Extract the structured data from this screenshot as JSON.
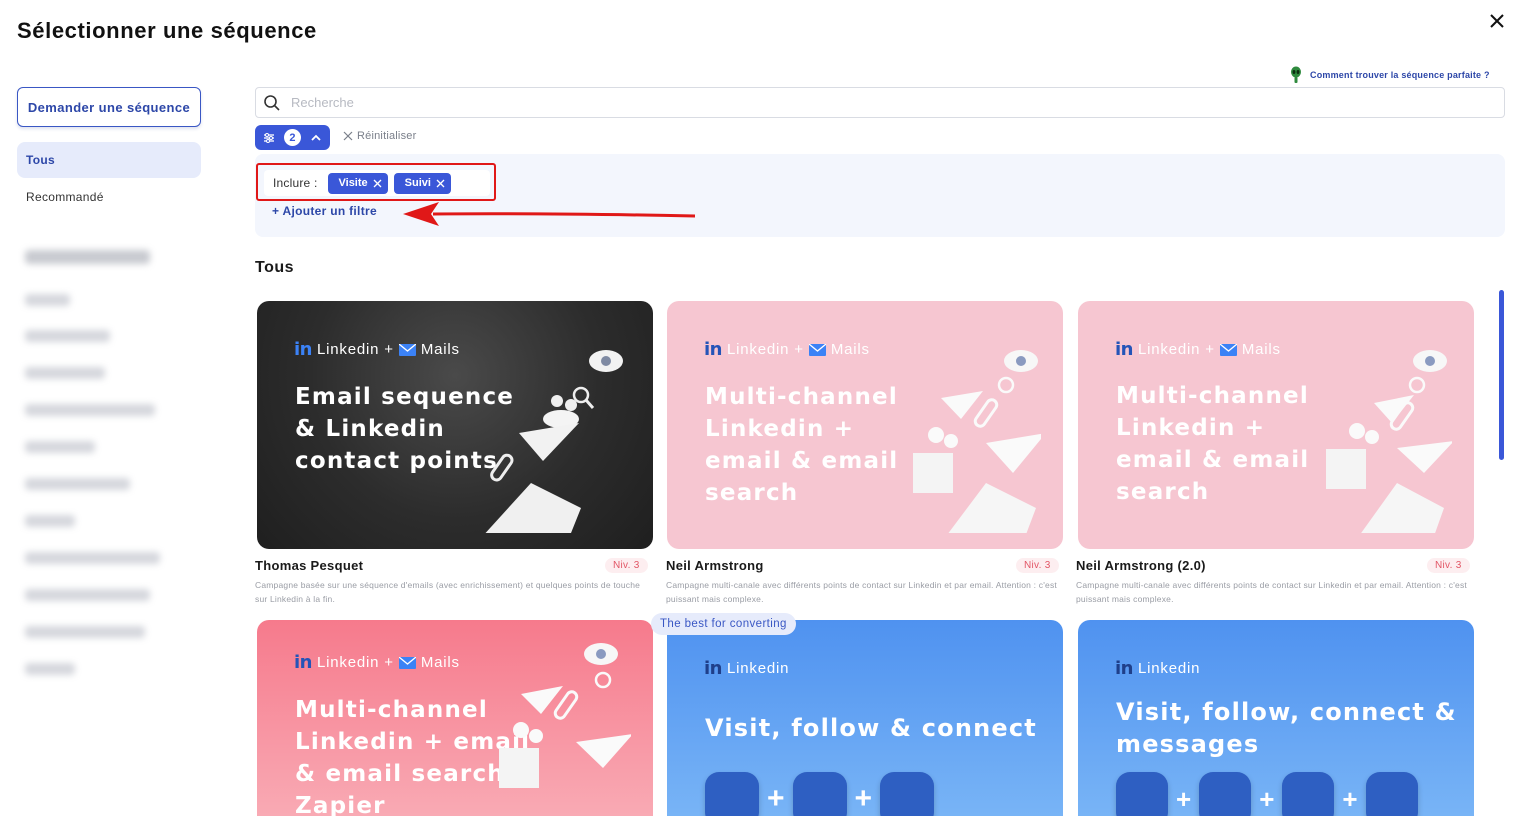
{
  "dialog": {
    "title": "Sélectionner une séquence",
    "close_label": "×"
  },
  "sidebar": {
    "request_button": "Demander une séquence",
    "items": [
      {
        "label": "Tous",
        "active": true
      },
      {
        "label": "Recommandé",
        "active": false
      }
    ]
  },
  "help": {
    "link_text": "Comment trouver la séquence parfaite ?"
  },
  "search": {
    "placeholder": "Recherche",
    "value": ""
  },
  "filters": {
    "count": "2",
    "reset_label": "Réinitialiser",
    "include_label": "Inclure :",
    "chips": [
      "Visite",
      "Suivi"
    ],
    "add_filter_label": "+ Ajouter un filtre"
  },
  "section": {
    "title": "Tous"
  },
  "cards": [
    {
      "header_linkedin": "Linkedin",
      "header_plus": "+",
      "header_mails": "Mails",
      "title": "Email sequence & Linkedin contact points",
      "author": "Thomas Pesquet",
      "level": "Niv. 3",
      "description": "Campagne basée sur une séquence d'emails (avec enrichissement) et quelques points de touche sur Linkedin à la fin."
    },
    {
      "header_linkedin": "Linkedin",
      "header_plus": "+",
      "header_mails": "Mails",
      "title": "Multi-channel Linkedin + email & email search",
      "author": "Neil Armstrong",
      "level": "Niv. 3",
      "description": "Campagne multi-canale avec différents points de contact sur Linkedin et par email. Attention : c'est puissant mais complexe."
    },
    {
      "header_linkedin": "Linkedin",
      "header_plus": "+",
      "header_mails": "Mails",
      "title": "Multi-channel Linkedin + email & email search",
      "author": "Neil Armstrong (2.0)",
      "level": "Niv. 3",
      "description": "Campagne multi-canale avec différents points de contact sur Linkedin et par email. Attention : c'est puissant mais complexe."
    },
    {
      "header_linkedin": "Linkedin",
      "header_plus": "+",
      "header_mails": "Mails",
      "title": "Multi-channel Linkedin + email & email search + Zapier"
    },
    {
      "badge": "The best for converting",
      "header_linkedin": "Linkedin",
      "title": "Visit, follow & connect"
    },
    {
      "header_linkedin": "Linkedin",
      "title": "Visit, follow, connect & messages"
    }
  ],
  "colors": {
    "accent": "#3a57d8",
    "highlight_red": "#e01818",
    "pink_card": "#f6c6d1",
    "blue_card": "#4f92f0"
  }
}
